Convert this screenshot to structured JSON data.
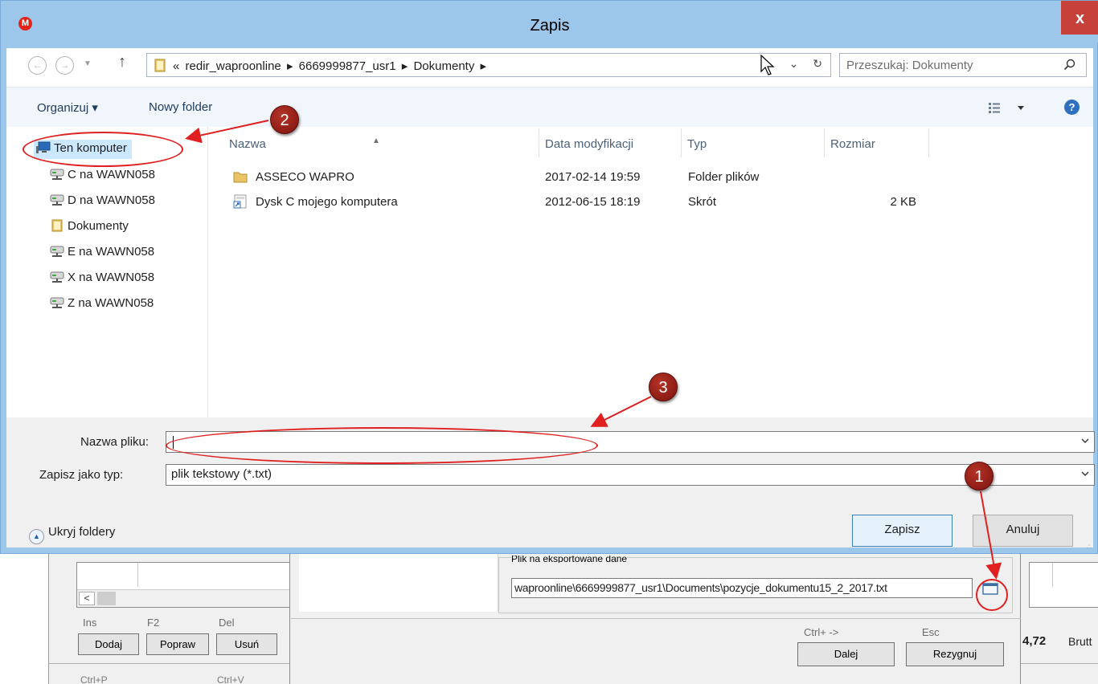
{
  "dialog": {
    "title": "Zapis",
    "close_label": "x",
    "app_icon_letter": "M"
  },
  "nav": {
    "back_icon": "back-arrow-icon",
    "forward_icon": "forward-arrow-icon",
    "up_icon": "up-arrow-icon",
    "address_prefix": "«",
    "breadcrumb": [
      "redir_waproonline",
      "6669999877_usr1",
      "Dokumenty"
    ],
    "search_placeholder": "Przeszukaj: Dokumenty"
  },
  "toolbar": {
    "organize_label": "Organizuj ▾",
    "new_folder_label": "Nowy folder",
    "help_label": "?"
  },
  "tree": {
    "root_label": "Ten komputer",
    "items": [
      "C na WAWN058",
      "D na WAWN058",
      "Dokumenty",
      "E na WAWN058",
      "X na WAWN058",
      "Z na WAWN058"
    ]
  },
  "files": {
    "columns": [
      "Nazwa",
      "Data modyfikacji",
      "Typ",
      "Rozmiar"
    ],
    "rows": [
      {
        "name": "ASSECO WAPRO",
        "date": "2017-02-14 19:59",
        "type": "Folder plików",
        "size": ""
      },
      {
        "name": "Dysk C mojego komputera",
        "date": "2012-06-15 18:19",
        "type": "Skrót",
        "size": "2 KB"
      }
    ]
  },
  "form": {
    "filename_label": "Nazwa pliku:",
    "filename_value": "",
    "filetype_label": "Zapisz jako typ:",
    "filetype_value": "plik tekstowy (*.txt)",
    "hide_folders_label": "Ukryj foldery",
    "save_label": "Zapisz",
    "cancel_label": "Anuluj"
  },
  "annotations": [
    "1",
    "2",
    "3"
  ],
  "background": {
    "scroll_left": "<",
    "keys": [
      "Ins",
      "F2",
      "Del"
    ],
    "buttons": [
      "Dodaj",
      "Popraw",
      "Usuń"
    ],
    "export_group_label": "Plik na eksportowane dane",
    "export_path": "waproonline\\6669999877_usr1\\Documents\\pozycje_dokumentu15_2_2017.txt",
    "next_key": "Ctrl+ ->",
    "next_label": "Dalej",
    "cancel_key": "Esc",
    "cancel_label": "Rezygnuj",
    "total_value": "4,72",
    "total_label": "Brutt",
    "bottom_keys": [
      "Ctrl+P",
      "Ctrl+V"
    ]
  },
  "colors": {
    "title_bar": "#9cc6ea",
    "close_button": "#c7413b",
    "annotation": "#e02020",
    "badge": "#8f1c14",
    "selection": "#cce8ff"
  }
}
